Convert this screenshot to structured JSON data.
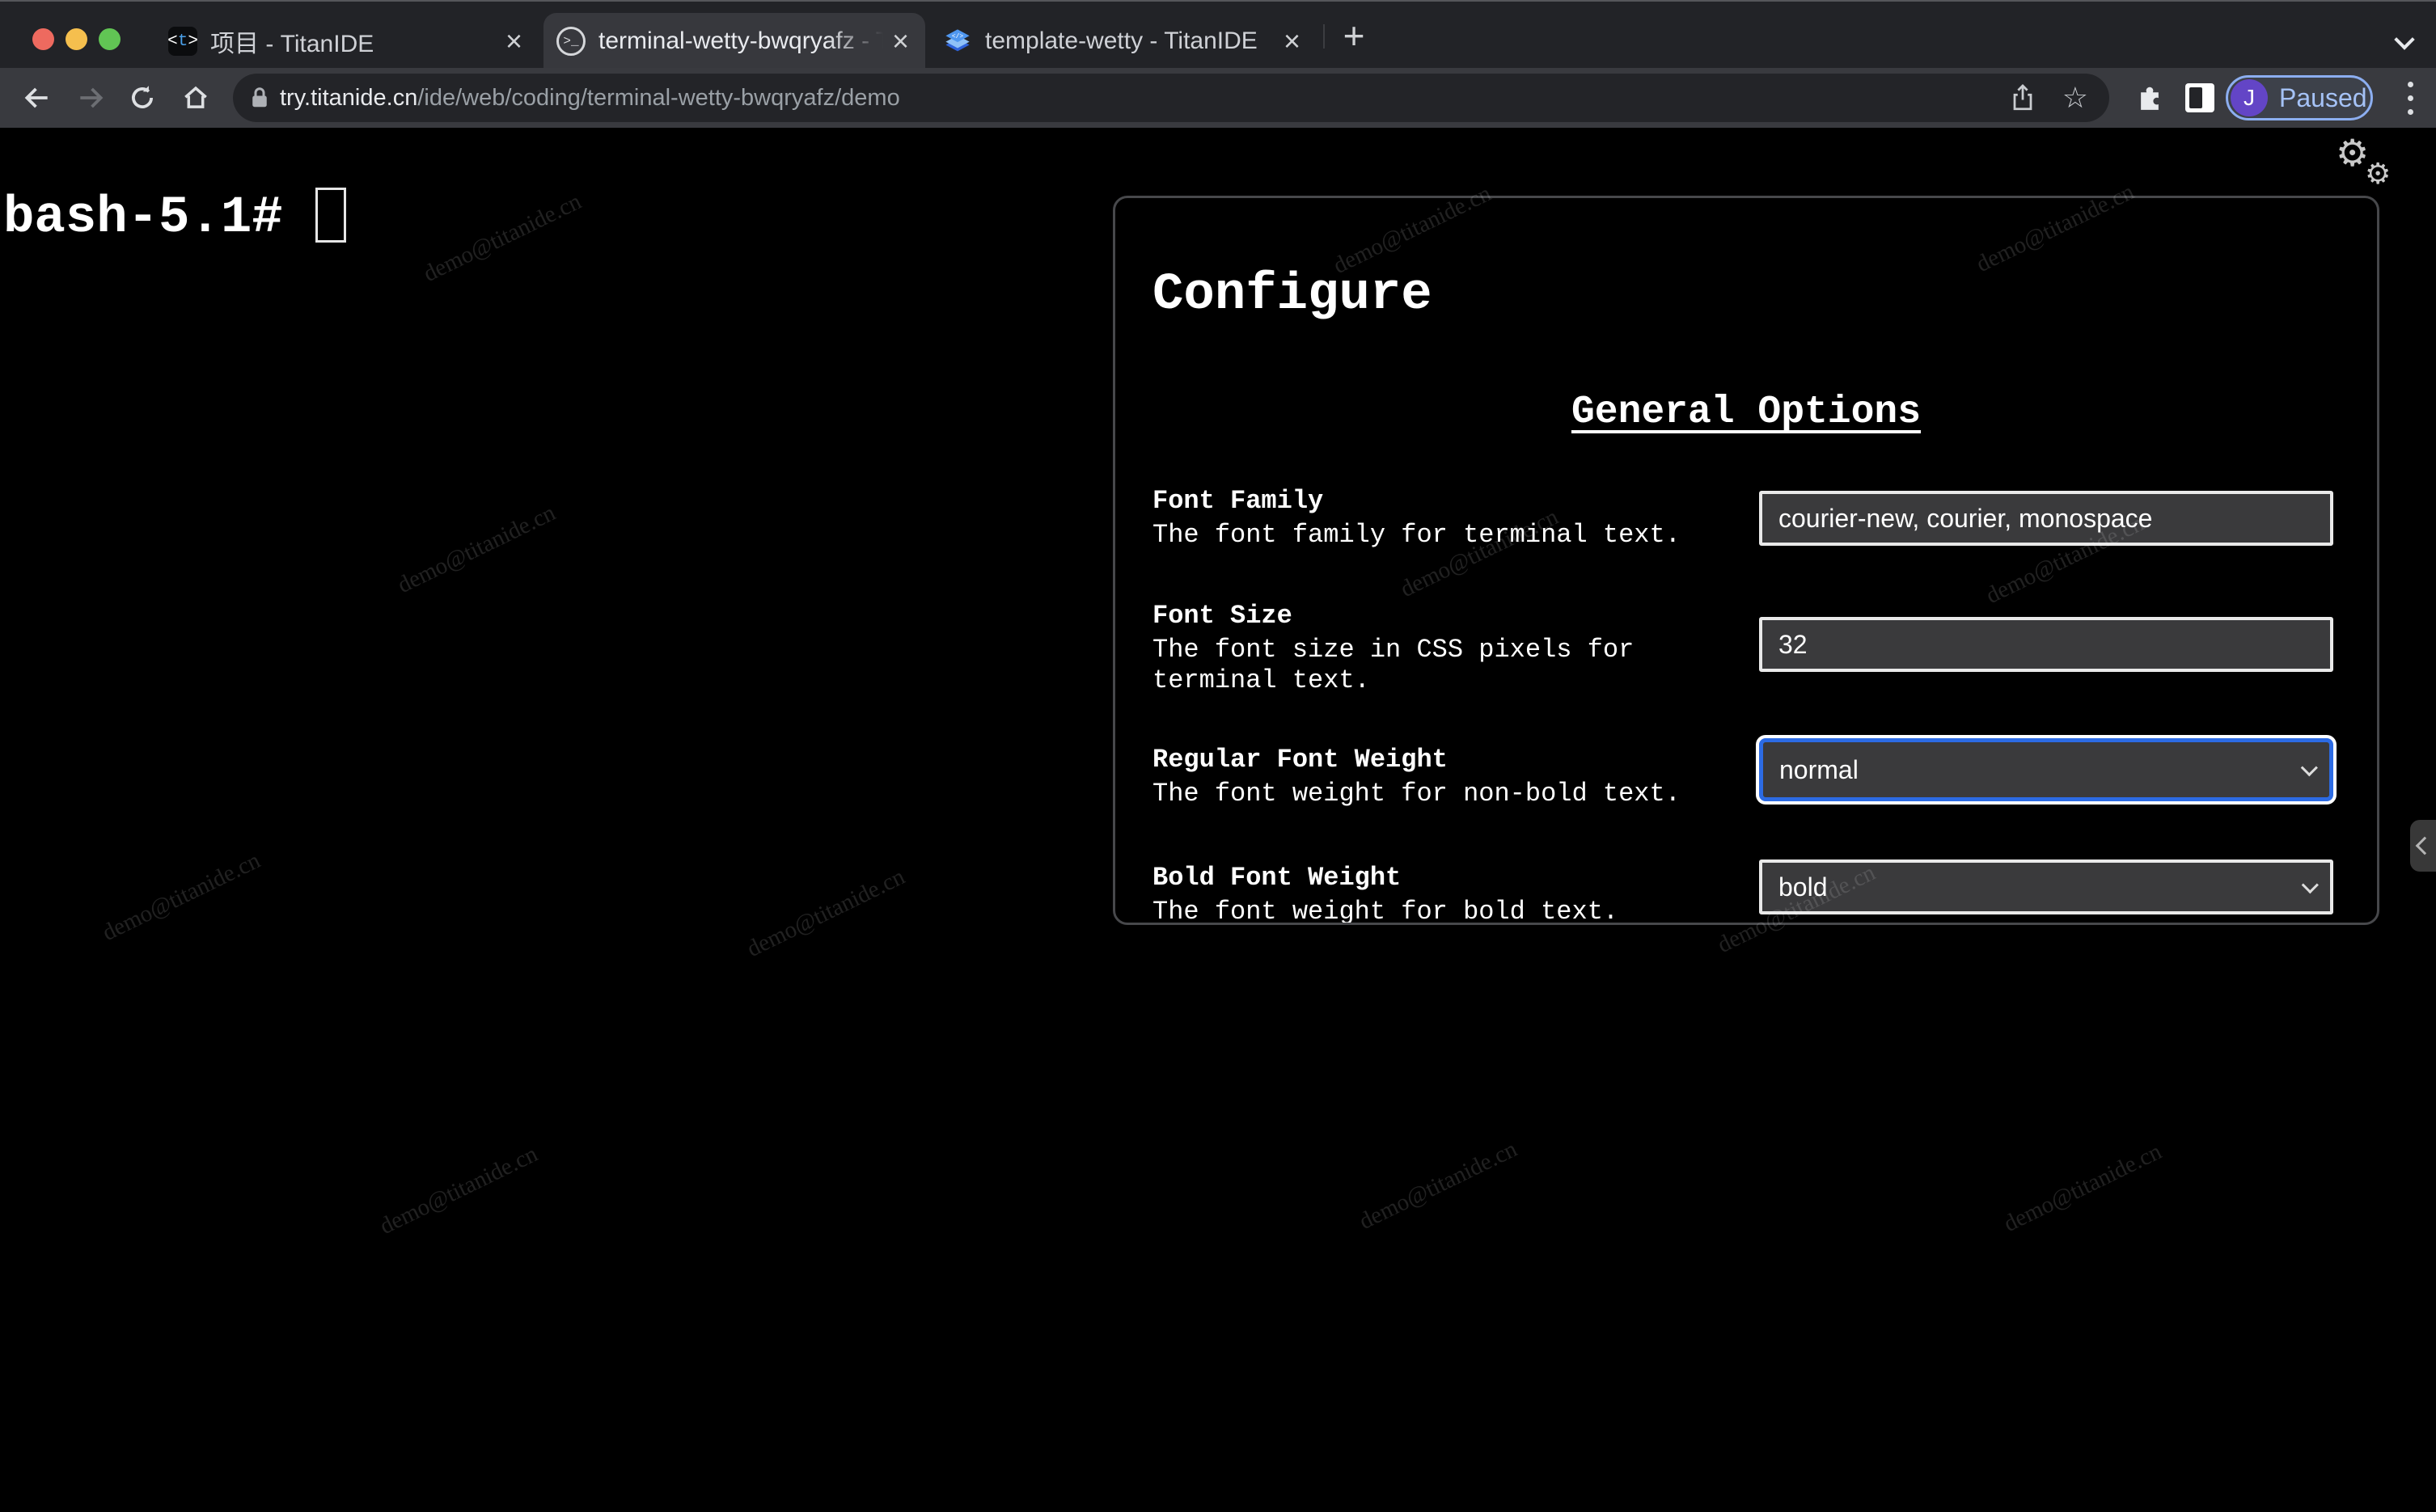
{
  "browser": {
    "traffic_lights": {
      "close": "#ee6a5f",
      "minimize": "#f5bf4e",
      "zoom": "#61c554"
    },
    "tabs": [
      {
        "title": "项目 - TitanIDE",
        "close_label": "×",
        "active": false
      },
      {
        "title": "terminal-wetty-bwqryafz - Tita",
        "close_label": "×",
        "active": true
      },
      {
        "title": "template-wetty - TitanIDE",
        "close_label": "×",
        "active": false
      }
    ],
    "new_tab_label": "+",
    "url": {
      "domain": "try.titanide.cn",
      "path": "/ide/web/coding/terminal-wetty-bwqryafz/demo"
    },
    "profile_badge": {
      "avatar_initial": "J",
      "label": "Paused"
    }
  },
  "terminal": {
    "prompt": "bash-5.1#"
  },
  "panel": {
    "title": "Configure",
    "section_heading": "General Options",
    "fields": [
      {
        "label": "Font Family",
        "description": "The font family for terminal text.",
        "value": "courier-new, courier, monospace",
        "type": "text"
      },
      {
        "label": "Font Size",
        "description": "The font size in CSS pixels for terminal text.",
        "value": "32",
        "type": "text"
      },
      {
        "label": "Regular Font Weight",
        "description": "The font weight for non-bold text.",
        "value": "normal",
        "type": "select",
        "focused": true
      },
      {
        "label": "Bold Font Weight",
        "description": "The font weight for bold text.",
        "value": "bold",
        "type": "select",
        "focused": false
      }
    ]
  },
  "icons": {
    "titan_favicon_text": "<t>",
    "terminal_favicon_text": ">_",
    "gear": "⚙",
    "bookmark_star": "☆"
  },
  "watermark": {
    "text": "demo@titanide.cn"
  },
  "colors": {
    "accent_focus_blue": "#2c6be4",
    "paused_border_blue": "#8caef0",
    "avatar_purple": "#6345c6",
    "toolbar_gray": "#393a3f",
    "tabstrip_gray": "#222327",
    "field_bg": "#3a3a3c",
    "terminal_bg": "#000000",
    "terminal_fg": "#ffffff"
  }
}
